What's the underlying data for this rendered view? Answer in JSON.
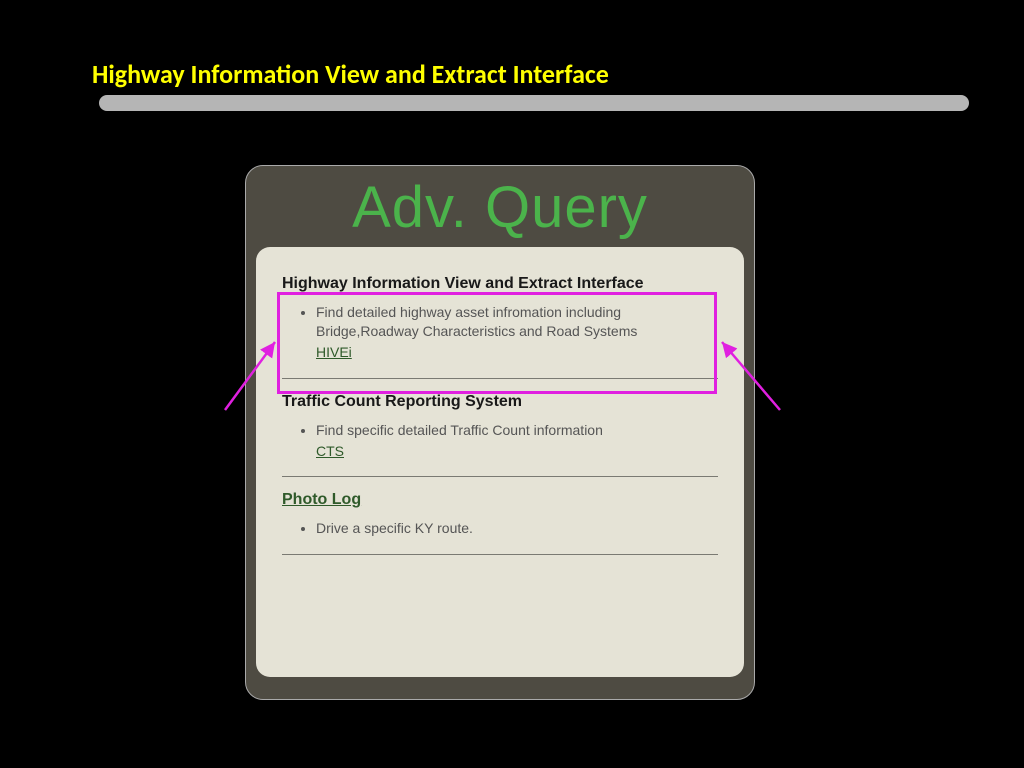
{
  "slide": {
    "title": "Highway Information View and Extract Interface"
  },
  "card": {
    "title": "Adv. Query",
    "sections": [
      {
        "heading": "Highway Information View and Extract Interface",
        "heading_link": false,
        "bullet": "Find detailed highway asset infromation including Bridge,Roadway Characteristics and Road Systems",
        "link": "HIVEi"
      },
      {
        "heading": "Traffic Count Reporting System",
        "heading_link": false,
        "bullet": "Find specific detailed Traffic Count information",
        "link": "CTS"
      },
      {
        "heading": "Photo Log",
        "heading_link": true,
        "bullet": "Drive a specific KY route.",
        "link": ""
      }
    ]
  }
}
